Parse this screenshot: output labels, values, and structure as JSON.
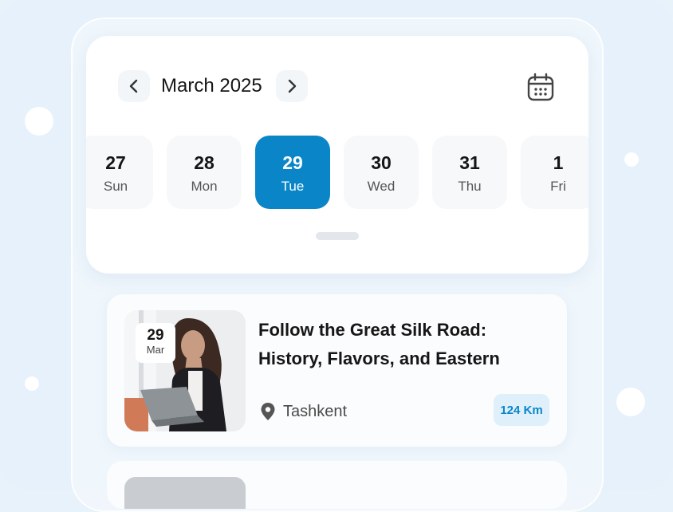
{
  "calendar": {
    "month_label": "March 2025",
    "days": [
      {
        "num": "27",
        "weekday": "Sun"
      },
      {
        "num": "28",
        "weekday": "Mon"
      },
      {
        "num": "29",
        "weekday": "Tue"
      },
      {
        "num": "30",
        "weekday": "Wed"
      },
      {
        "num": "31",
        "weekday": "Thu"
      },
      {
        "num": "1",
        "weekday": "Fri"
      }
    ],
    "selected_index": 2,
    "icons": {
      "prev": "chevron-left-icon",
      "next": "chevron-right-icon",
      "calendar": "calendar-icon"
    }
  },
  "event": {
    "date_day": "29",
    "date_month": "Mar",
    "title_line1": "Follow the Great Silk Road:",
    "title_line2": "History, Flavors, and Eastern",
    "location": "Tashkent",
    "distance": "124 Km"
  },
  "colors": {
    "accent": "#0a86c8",
    "accent_light": "#dff0fb",
    "background": "#e6f1fb"
  }
}
